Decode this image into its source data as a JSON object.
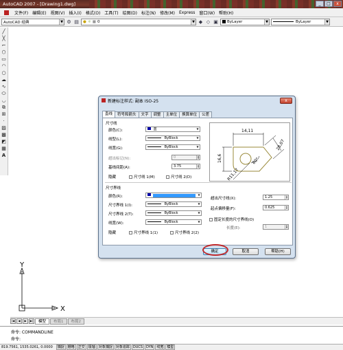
{
  "title_bar": {
    "text": "AutoCAD 2007 - [Drawing1.dwg]",
    "min": "_",
    "max": "□",
    "close": "x"
  },
  "menu": {
    "items": [
      "文件(F)",
      "编辑(E)",
      "视图(V)",
      "插入(I)",
      "格式(O)",
      "工具(T)",
      "绘图(D)",
      "标注(N)",
      "修改(M)",
      "Express",
      "窗口(W)",
      "帮助(H)"
    ]
  },
  "toolbar": {
    "workspace": "AutoCAD 经典",
    "layer": "0",
    "color": "ByLayer",
    "linetype": "ByLayer"
  },
  "layout_tabs": {
    "model": "模型",
    "layout1": "布局1",
    "layout2": "布局2"
  },
  "command": {
    "line1": "命令: COMMANDLINE",
    "line2": "命令:"
  },
  "status": {
    "coords": "819.7561, 1535.0261, 0.0000",
    "buttons": [
      "捕捉",
      "栅格",
      "正交",
      "极轴",
      "对象捕捉",
      "对象追踪",
      "DUCS",
      "DYN",
      "线宽",
      "模型"
    ]
  },
  "ucs": {
    "x": "X",
    "y": "Y"
  },
  "dialog": {
    "title": "新建标注样式: 副本 ISO-25",
    "close": "x",
    "tabs": [
      "直线",
      "符号和箭头",
      "文字",
      "调整",
      "主单位",
      "换算单位",
      "公差"
    ],
    "dimline": {
      "group": "尺寸线",
      "color_label": "颜色(C):",
      "color_value": "蓝",
      "linetype_label": "线型(L):",
      "linetype_value": "ByBlock",
      "lineweight_label": "线宽(G):",
      "lineweight_value": "ByBlock",
      "extend_label": "超出标记(N):",
      "extend_value": "0",
      "baseline_label": "基线间距(A):",
      "baseline_value": "3.75",
      "suppress_label": "隐藏",
      "sup1": "尺寸线 1(M)",
      "sup2": "尺寸线 2(D)"
    },
    "extline": {
      "group": "尺寸界线",
      "color_label": "颜色(R):",
      "lt1_label": "尺寸界线 1(I):",
      "lt1_value": "ByBlock",
      "lt2_label": "尺寸界线 2(T):",
      "lt2_value": "ByBlock",
      "lw_label": "线宽(W):",
      "lw_value": "ByBlock",
      "suppress_label": "隐藏",
      "sup1": "尺寸界线 1(1)",
      "sup2": "尺寸界线 2(2)",
      "beyond_label": "超出尺寸线(X):",
      "beyond_value": "1.25",
      "offset_label": "起点偏移量(F):",
      "offset_value": "0.625",
      "fixed_label": "固定长度的尺寸界线(O)",
      "length_label": "长度(E):",
      "length_value": "1"
    },
    "preview": {
      "dim1": "14,11",
      "dim2": "16,6",
      "dim3": "28,07",
      "dim4": "R11,17",
      "angle": "80°"
    },
    "buttons": {
      "ok": "确定",
      "cancel": "取消",
      "help": "帮助(H)"
    }
  },
  "colors": {
    "dimline_color": "#0000a8",
    "extline_color": "#3399ff",
    "highlight_oval": "#c0282a"
  }
}
